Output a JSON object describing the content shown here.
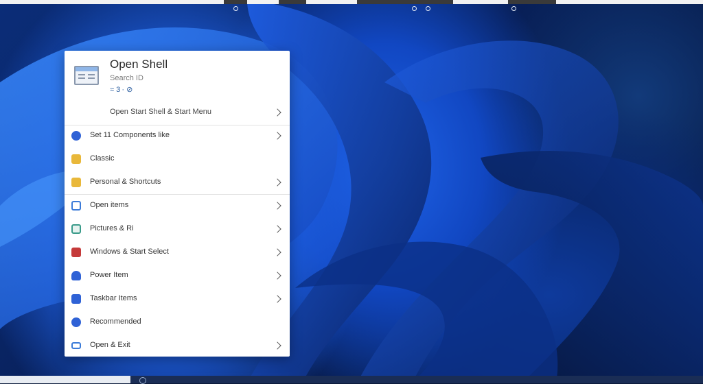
{
  "menu": {
    "app_title": "Open Shell",
    "app_subtitle": "Search ID",
    "app_meta": "≈ 3 · ⊘",
    "header_row_label": "Open Start Shell & Start Menu",
    "items": [
      {
        "label": "Set 11 Components like",
        "icon": "gear-icon",
        "color": "#2f62d6",
        "has_submenu": true
      },
      {
        "label": "Classic",
        "icon": "folder-icon",
        "color": "#e9b83a",
        "has_submenu": false
      },
      {
        "label": "Personal & Shortcuts",
        "icon": "folder-icon",
        "color": "#e9b83a",
        "has_submenu": true
      },
      {
        "label": "Open items",
        "icon": "window-icon",
        "color": "#3b7bd8",
        "has_submenu": true
      },
      {
        "label": "Pictures & Ri",
        "icon": "image-icon",
        "color": "#3a9b8a",
        "has_submenu": true
      },
      {
        "label": "Windows & Start Select",
        "icon": "app-icon",
        "color": "#c53a3a",
        "has_submenu": true
      },
      {
        "label": "Power Item",
        "icon": "user-icon",
        "color": "#2f62d6",
        "has_submenu": true
      },
      {
        "label": "Taskbar Items",
        "icon": "people-icon",
        "color": "#2f62d6",
        "has_submenu": true
      },
      {
        "label": "Recommended",
        "icon": "network-icon",
        "color": "#2f62d6",
        "has_submenu": false
      },
      {
        "label": "Open & Exit",
        "icon": "monitor-icon",
        "color": "#3b7bd8",
        "has_submenu": true
      }
    ]
  },
  "colors": {
    "accent": "#1e5fe0",
    "menu_bg": "#ffffff"
  }
}
